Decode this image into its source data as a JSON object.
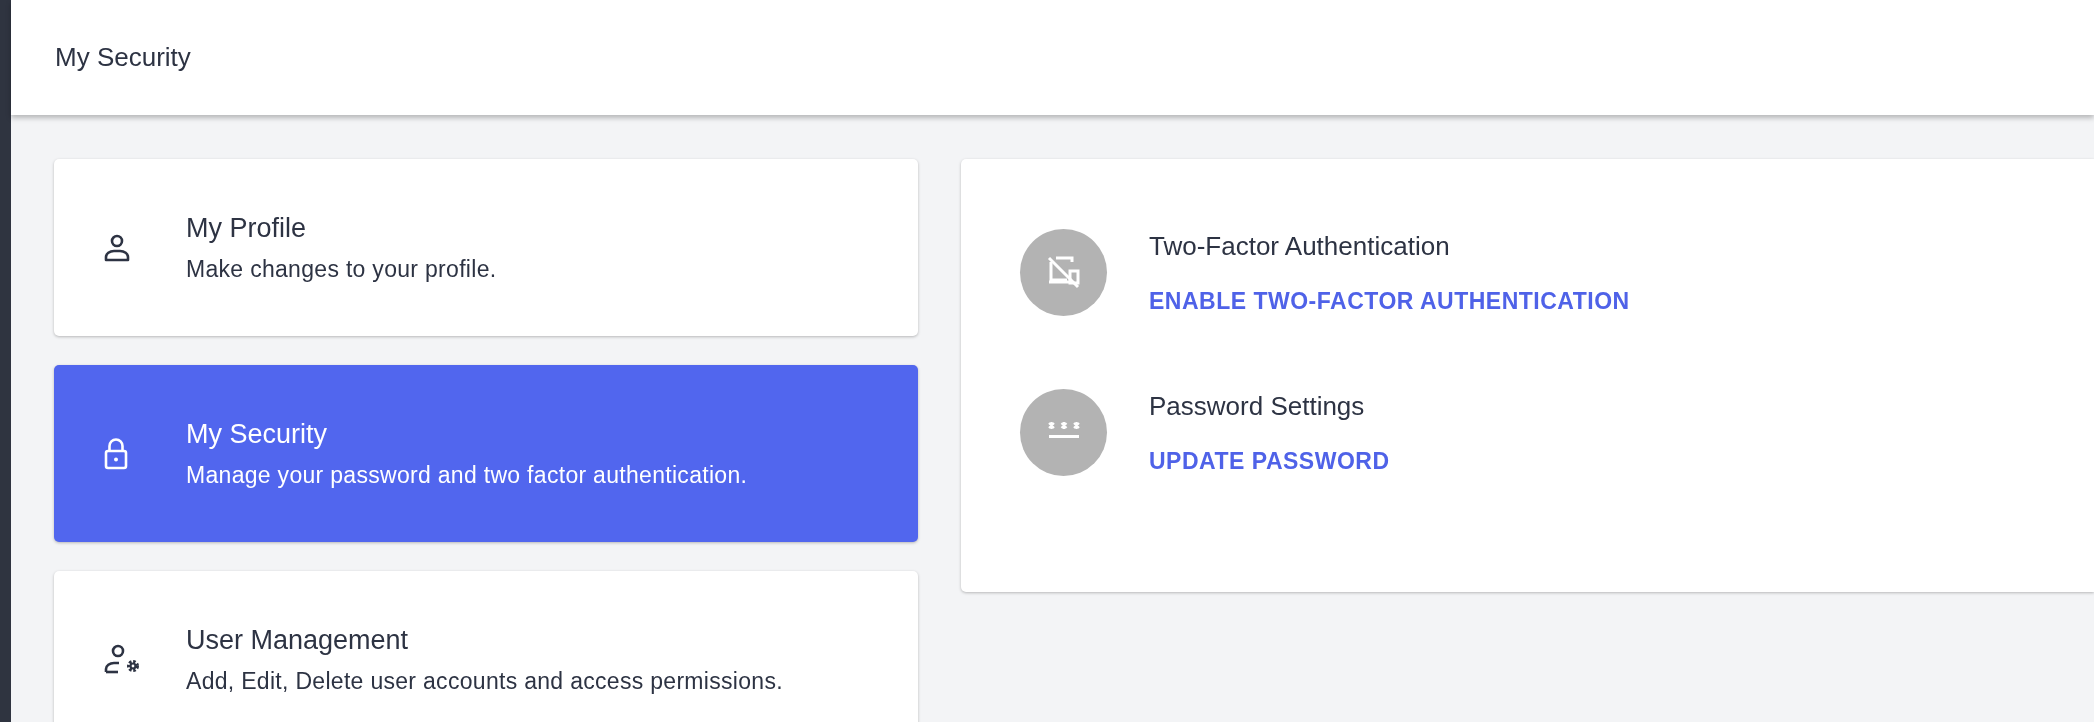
{
  "header": {
    "title": "My Security"
  },
  "menu": [
    {
      "title": "My Profile",
      "description": "Make changes to your profile.",
      "selected": false
    },
    {
      "title": "My Security",
      "description": "Manage your password and two factor authentication.",
      "selected": true
    },
    {
      "title": "User Management",
      "description": "Add, Edit, Delete user accounts and access permissions.",
      "selected": false
    }
  ],
  "settings": [
    {
      "title": "Two-Factor Authentication",
      "action": "ENABLE TWO-FACTOR AUTHENTICATION"
    },
    {
      "title": "Password Settings",
      "action": "UPDATE PASSWORD"
    }
  ]
}
